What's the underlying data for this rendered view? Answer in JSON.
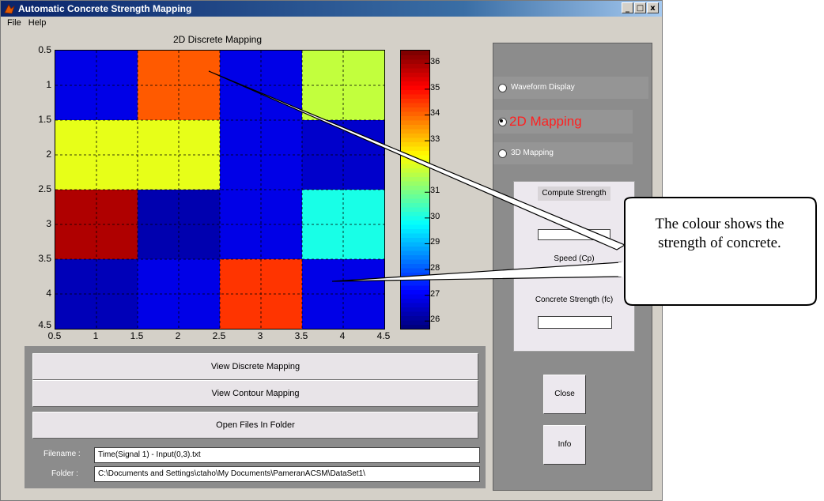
{
  "window": {
    "title": "Automatic Concrete Strength Mapping",
    "buttons": [
      "_",
      "□",
      "x"
    ]
  },
  "menu": {
    "items": [
      "File",
      "Help"
    ]
  },
  "chart_data": {
    "type": "heatmap",
    "title": "2D Discrete Mapping",
    "x_ticks": [
      "0.5",
      "1",
      "1.5",
      "2",
      "2.5",
      "3",
      "3.5",
      "4",
      "4.5"
    ],
    "y_ticks": [
      "0.5",
      "1",
      "1.5",
      "2",
      "2.5",
      "3",
      "3.5",
      "4",
      "4.5"
    ],
    "xlim": [
      0.5,
      4.5
    ],
    "ylim": [
      0.5,
      4.5
    ],
    "grid": true,
    "values": [
      [
        26.8,
        34.2,
        26.8,
        31.8
      ],
      [
        32.2,
        32.2,
        26.8,
        26.5
      ],
      [
        36.0,
        26.2,
        26.8,
        30.0
      ],
      [
        26.3,
        26.8,
        34.6,
        26.8
      ]
    ],
    "colorbar": {
      "min": 25.7,
      "max": 36.5,
      "ticks": [
        "26",
        "27",
        "28",
        "29",
        "30",
        "31",
        "33",
        "34",
        "35",
        "36"
      ]
    }
  },
  "buttons": {
    "view_discrete": "View Discrete Mapping",
    "view_contour": "View Contour Mapping",
    "open_files": "Open Files In Folder",
    "close": "Close",
    "info": "Info"
  },
  "fields": {
    "filename_label": "Filename :",
    "filename_value": "Time(Signal 1) - Input(0,3).txt",
    "folder_label": "Folder :",
    "folder_value": "C:\\Documents and Settings\\ctaho\\My Documents\\PameranACSM\\DataSet1\\"
  },
  "options": {
    "waveform": "Waveform Display",
    "mapping2d": "2D Mapping",
    "mapping3d": "3D Mapping",
    "selected": "2D Mapping"
  },
  "compute": {
    "button": "Compute Strength",
    "speed_label": "Speed (Cp)",
    "strength_label": "Concrete Strength (fc)"
  },
  "callout": {
    "text": "The colour shows the strength of concrete."
  }
}
